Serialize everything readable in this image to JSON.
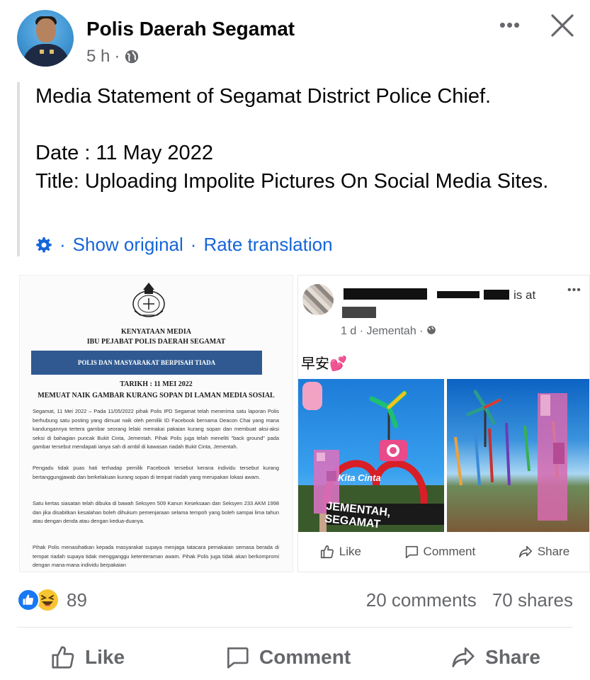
{
  "header": {
    "page_name": "Polis Daerah Segamat",
    "time": "5 h",
    "separator": "·",
    "privacy_icon": "globe-icon",
    "more_icon": "more-horizontal-icon",
    "close_icon": "close-icon"
  },
  "post": {
    "line1": "Media Statement of Segamat District Police Chief.",
    "line2": "Date : 11 May 2022",
    "line3": "Title: Uploading Impolite Pictures On Social Media Sites.",
    "translation": {
      "settings_icon": "gear-icon",
      "show_original": "Show original",
      "rate_translation": "Rate translation"
    }
  },
  "document": {
    "header1": "KENYATAAN MEDIA",
    "header2": "IBU PEJABAT POLIS DAERAH SEGAMAT",
    "banner": "POLIS DAN MASYARAKAT BERPISAH TIADA",
    "date": "TARIKH : 11 MEI 2022",
    "title": "MEMUAT NAIK GAMBAR KURANG SOPAN DI LAMAN MEDIA SOSIAL",
    "p1": "Segamat, 11 Mei 2022 – Pada 11/05/2022 pihak Polis IPD Segamat telah menerima satu laporan Polis berhubung satu posting yang dimuat naik oleh pemilik ID Facebook bernama Deacon Chai yang mana kandungannya tertera gambar seorang lelaki memakai pakaian kurang sopan dan membuat aksi-aksi seksi di bahagian puncak Bukit Cinta, Jementah. Pihak Polis juga telah meneliti \"back ground\" pada gambar tersebut mendapati ianya sah di ambil di kawasan riadah Bukit Cinta, Jementah.",
    "p2": "Pengadu tidak puas hati terhadap pemilik Facebook tersebut kerana individu tersebut kurang bertanggungjawab dan berkelakuan kurang sopan di tempat riadah yang merupakan lokasi awam.",
    "p3": "Satu kertas siasatan telah dibuka di bawah Seksyen 509 Kanun Keseksaan dan Seksyen 233 AKM 1998 dan jika disabitkan kesalahan boleh dihukum pemenjaraan selama tempoh yang boleh sampai lima tahun atau dengan denda atau dengan kedua-duanya.",
    "p4": "Pihak Polis menasihatkan kepada masyarakat supaya menjaga tatacara pemakaian semasa berada di tempat riadah supaya tidak mengganggu ketenteraman awam. Pihak Polis juga tidak akan berkompromi dengan mana-mana individu berpakaian"
  },
  "shared_post": {
    "is_at": "is at",
    "time": "1 d · Jementah · ",
    "greeting": "早安💕",
    "sign_text": "JEMENTAH, SEGAMAT",
    "sign_script": "Kita Cinta",
    "like": "Like",
    "comment": "Comment",
    "share": "Share"
  },
  "stats": {
    "reaction_count": "89",
    "comments": "20 comments",
    "shares": "70 shares"
  },
  "actions": {
    "like": "Like",
    "comment": "Comment",
    "share": "Share"
  },
  "colors": {
    "link": "#1565d8",
    "muted": "#65676b",
    "like_blue": "#1877f2",
    "haha_yellow": "#f7c531",
    "doc_banner": "#2f5990"
  }
}
